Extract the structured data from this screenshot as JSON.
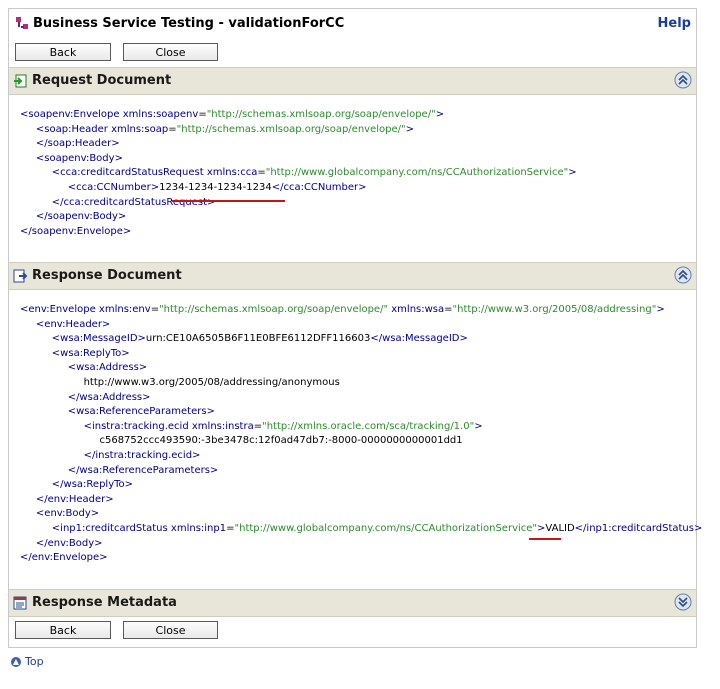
{
  "window": {
    "title": "Business Service Testing - validationForCC",
    "help_label": "Help"
  },
  "buttons": {
    "back_label": "Back",
    "close_label": "Close"
  },
  "sections": {
    "request": {
      "title": "Request Document"
    },
    "response": {
      "title": "Response Document"
    },
    "metadata": {
      "title": "Response Metadata"
    }
  },
  "request_xml": {
    "envelope_open_tag": "<soapenv:Envelope",
    "envelope_ns_attr": "xmlns:soapenv",
    "envelope_ns_val": "\"http://schemas.xmlsoap.org/soap/envelope/\"",
    "header_open_tag": "<soap:Header",
    "header_ns_attr": "xmlns:soap",
    "header_ns_val": "\"http://schemas.xmlsoap.org/soap/envelope/\"",
    "header_close": "</soap:Header>",
    "body_open": "<soapenv:Body>",
    "req_open_tag": "<cca:creditcardStatusRequest",
    "req_ns_attr": "xmlns:cca",
    "req_ns_val": "\"http://www.globalcompany.com/ns/CCAuthorizationService\"",
    "ccnumber_open": "<cca:CCNumber>",
    "ccnumber_value": "1234-1234-1234-1234",
    "ccnumber_close": "</cca:CCNumber>",
    "req_close": "</cca:creditcardStatusRequest>",
    "body_close": "</soapenv:Body>",
    "envelope_close": "</soapenv:Envelope>"
  },
  "response_xml": {
    "envelope_open_tag": "<env:Envelope",
    "env_ns_attr": "xmlns:env",
    "env_ns_val": "\"http://schemas.xmlsoap.org/soap/envelope/\"",
    "wsa_ns_attr": "xmlns:wsa",
    "wsa_ns_val": "\"http://www.w3.org/2005/08/addressing\"",
    "header_open": "<env:Header>",
    "msgid_open": "<wsa:MessageID>",
    "msgid_value": "urn:CE10A6505B6F11E0BFE6112DFF116603",
    "msgid_close": "</wsa:MessageID>",
    "replyto_open": "<wsa:ReplyTo>",
    "address_open": "<wsa:Address>",
    "address_value": "http://www.w3.org/2005/08/addressing/anonymous",
    "address_close": "</wsa:Address>",
    "refparams_open": "<wsa:ReferenceParameters>",
    "ecid_open_tag": "<instra:tracking.ecid",
    "ecid_ns_attr": "xmlns:instra",
    "ecid_ns_val": "\"http://xmlns.oracle.com/sca/tracking/1.0\"",
    "ecid_value": "c568752ccc493590:-3be3478c:12f0ad47db7:-8000-0000000000001dd1",
    "ecid_close": "</instra:tracking.ecid>",
    "refparams_close": "</wsa:ReferenceParameters>",
    "replyto_close": "</wsa:ReplyTo>",
    "header_close": "</env:Header>",
    "body_open": "<env:Body>",
    "status_open_tag": "<inp1:creditcardStatus",
    "status_ns_attr": "xmlns:inp1",
    "status_ns_val": "\"http://www.globalcompany.com/ns/CCAuthorizationService\"",
    "status_value": "VALID",
    "status_close": "</inp1:creditcardStatus>",
    "body_close": "</env:Body>",
    "envelope_close": "</env:Envelope>"
  },
  "footer": {
    "top_label": "Top"
  },
  "colors": {
    "tag": "#00008b",
    "attr_value": "#2e8b2e",
    "section_bg": "#e8e6d8",
    "link": "#1a3d9e",
    "highlight_underline": "#c01818"
  }
}
